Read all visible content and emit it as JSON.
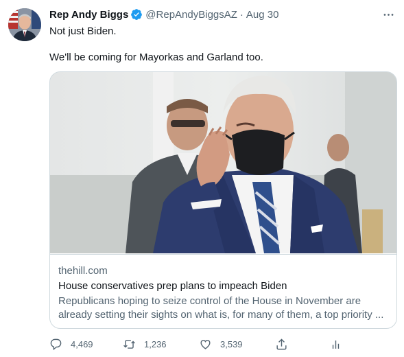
{
  "tweet": {
    "author": {
      "name": "Rep Andy Biggs",
      "handle": "@RepAndyBiggsAZ",
      "separator": "·",
      "time": "Aug 30",
      "verified": true
    },
    "text_line1": "Not just Biden.",
    "text_line2": "We'll be coming for Mayorkas and Garland too.",
    "card": {
      "domain": "thehill.com",
      "title": "House conservatives prep plans to impeach Biden",
      "description_line1": "Republicans hoping to seize control of the House in November are",
      "description_line2": "already setting their sights on what is, for many of them, a top priority ..."
    },
    "actions": {
      "replies": "4,469",
      "retweets": "1,236",
      "likes": "3,539"
    }
  },
  "colors": {
    "text_primary": "#0f1419",
    "text_secondary": "#536471",
    "verified_blue": "#1d9bf0",
    "border": "#cfd9de"
  },
  "icons": [
    "more-icon",
    "verified-badge-icon",
    "reply-icon",
    "retweet-icon",
    "like-icon",
    "share-icon",
    "analytics-icon"
  ]
}
